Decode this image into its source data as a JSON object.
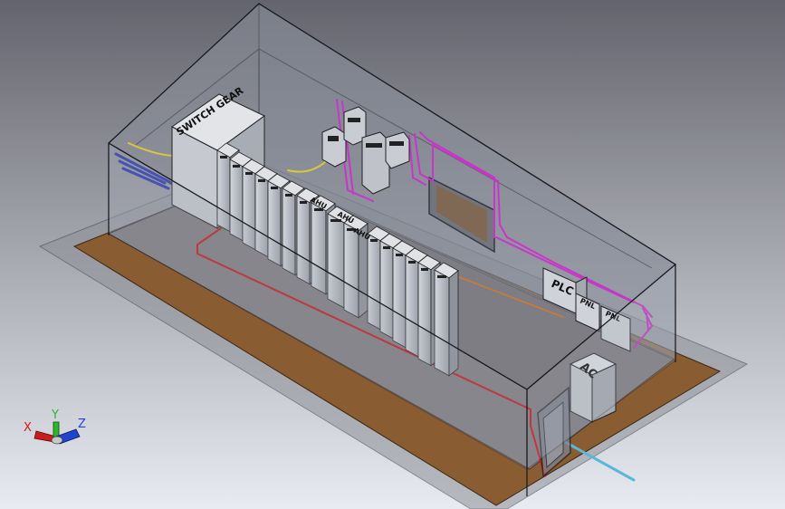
{
  "viewport": {
    "background_top": "#63646d",
    "background_bottom": "#e9ebf2"
  },
  "labels": {
    "switchgear": "SWITCH GEAR",
    "ahu_1": "AHU",
    "ahu_2": "AHU",
    "ahu_3": "AHU",
    "plc": "PLC",
    "panel_a": "PNL",
    "panel_b": "PNL",
    "ac": "AC"
  },
  "triad": {
    "x": "X",
    "y": "Y",
    "z": "Z"
  },
  "colors": {
    "floor": "#8a5c32",
    "enclosure_glass": "#8c909c",
    "cabinet": "#b8bcc4",
    "cable_yellow": "#d8c83a",
    "cable_blue": "#2c38b0",
    "cable_green": "#2aa42a",
    "cable_red": "#c8141a",
    "cable_magenta": "#c836c8",
    "cable_orange": "#d07a2a",
    "cable_cyan": "#58b8d8"
  }
}
